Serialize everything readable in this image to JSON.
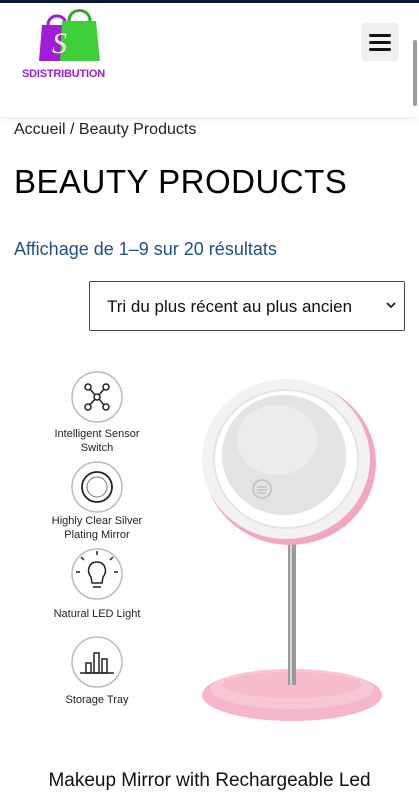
{
  "header": {
    "logo_text": "SDISTRIBUTION",
    "logo_letter": "S"
  },
  "breadcrumb": {
    "home": "Accueil",
    "separator": " / ",
    "current": "Beauty Products"
  },
  "page_title": "BEAUTY PRODUCTS",
  "results_text": "Affichage de 1–9 sur 20 résultats",
  "sort": {
    "selected": "Tri du plus récent au plus ancien"
  },
  "product": {
    "title": "Makeup Mirror with Rechargeable Led",
    "features": [
      {
        "line1": "Intelligent Sensor",
        "line2": "Switch"
      },
      {
        "line1": "Highly Clear Silver",
        "line2": "Plating Mirror"
      },
      {
        "line1": "Natural LED Light",
        "line2": ""
      },
      {
        "line1": "Storage Tray",
        "line2": ""
      }
    ]
  },
  "colors": {
    "accent_blue": "#1d4f8a",
    "logo_purple": "#9b1fd6",
    "logo_green": "#3ecf3a",
    "mirror_pink": "#f4b6c8"
  }
}
